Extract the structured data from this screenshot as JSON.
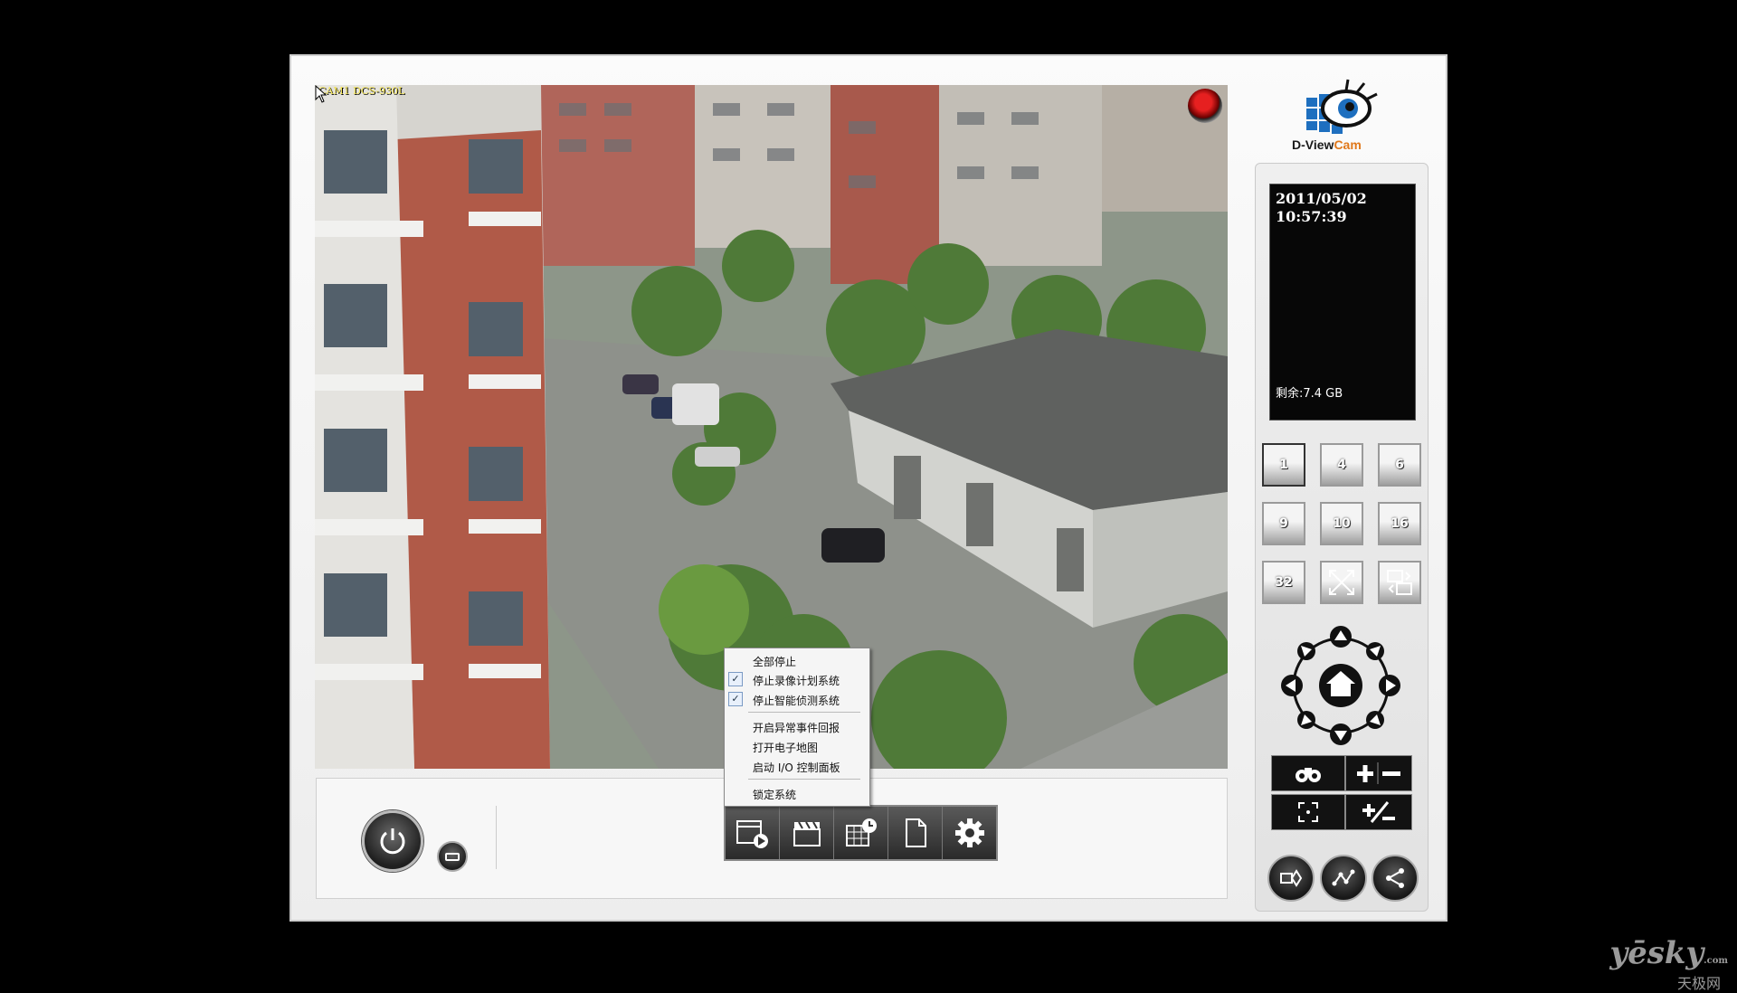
{
  "video": {
    "camera_label": "CAM1 DCS-930L"
  },
  "context_menu": {
    "items": [
      {
        "label": "全部停止",
        "checked": false
      },
      {
        "label": "停止录像计划系统",
        "checked": true
      },
      {
        "label": "停止智能侦测系统",
        "checked": true
      },
      {
        "label": "开启异常事件回报",
        "checked": false
      },
      {
        "label": "打开电子地图",
        "checked": false
      },
      {
        "label": "启动 I/O 控制面板",
        "checked": false
      },
      {
        "label": "锁定系统",
        "checked": false
      }
    ],
    "check_glyph": "✓"
  },
  "logo": {
    "text_d": "D-View",
    "text_cam": "Cam"
  },
  "info_panel": {
    "date": "2011/05/02",
    "time": "10:57:39",
    "free_space": "剩余:7.4 GB"
  },
  "layouts": [
    "1",
    "4",
    "6",
    "9",
    "10",
    "16",
    "32"
  ],
  "toolbar": {
    "icons": [
      "playback-icon",
      "clapperboard-icon",
      "schedule-icon",
      "document-icon",
      "gear-icon"
    ]
  },
  "colors": {
    "accent_orange": "#e0781b",
    "logo_blue": "#1e6fbf",
    "record_red": "#e62020"
  },
  "watermark": {
    "brand": "yēsky",
    "suffix": ".com",
    "cn": "天极网"
  }
}
